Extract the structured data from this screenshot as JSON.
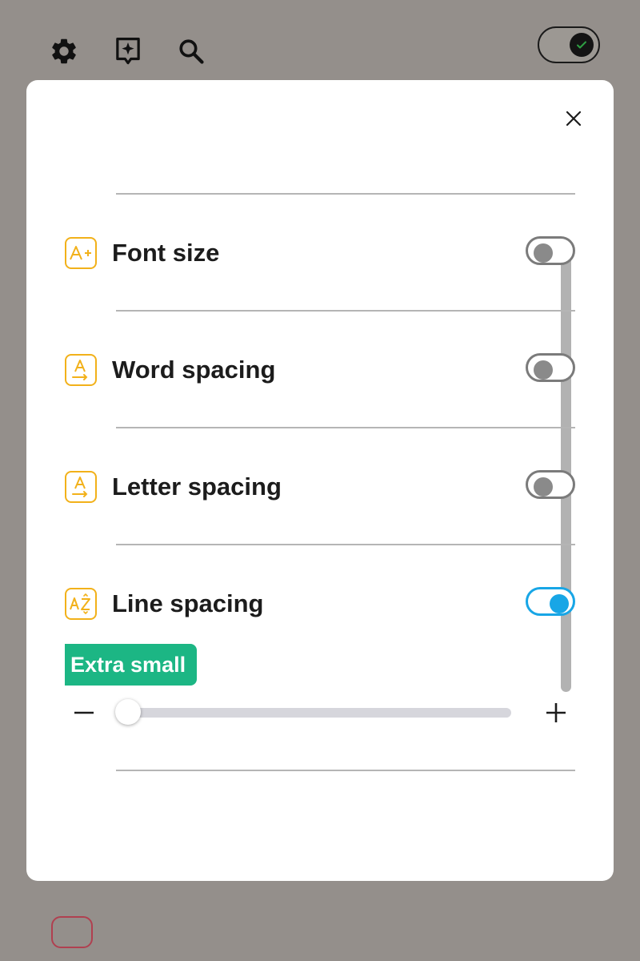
{
  "toolbar": {
    "icons": [
      "gear-icon",
      "ai-sparkle-icon",
      "search-icon"
    ],
    "toggle_state": "on",
    "toggle_check_color": "#2ea043"
  },
  "modal": {
    "close_icon": "close-icon",
    "settings": [
      {
        "label": "Font size",
        "icon": "font-size-icon",
        "enabled": false
      },
      {
        "label": "Word spacing",
        "icon": "word-spacing-icon",
        "enabled": false
      },
      {
        "label": "Letter spacing",
        "icon": "letter-spacing-icon",
        "enabled": false
      },
      {
        "label": "Line spacing",
        "icon": "line-spacing-icon",
        "enabled": true
      }
    ],
    "line_spacing": {
      "level_label": "Extra small",
      "slider_value": 0,
      "minus_icon": "minus-icon",
      "plus_icon": "plus-icon"
    }
  },
  "colors": {
    "accent_icon": "#f2b11a",
    "toggle_on": "#18a6e6",
    "badge": "#1cb684",
    "backdrop": "#948f8b"
  }
}
